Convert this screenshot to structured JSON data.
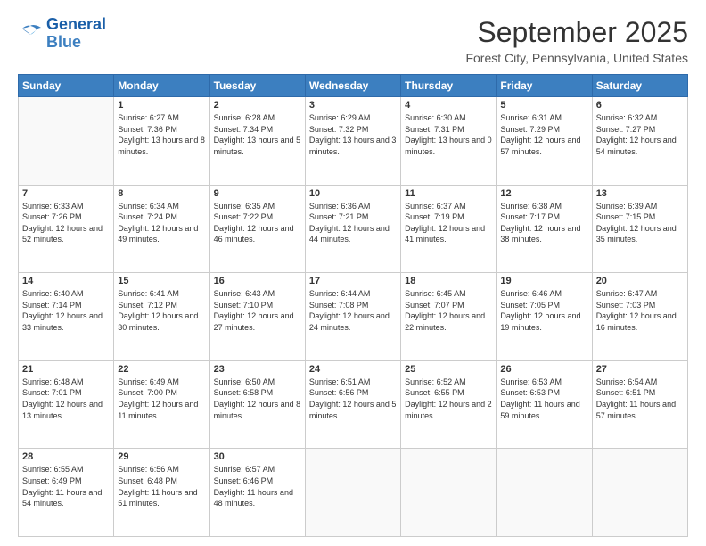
{
  "header": {
    "logo_line1": "General",
    "logo_line2": "Blue",
    "month": "September 2025",
    "location": "Forest City, Pennsylvania, United States"
  },
  "days_of_week": [
    "Sunday",
    "Monday",
    "Tuesday",
    "Wednesday",
    "Thursday",
    "Friday",
    "Saturday"
  ],
  "weeks": [
    [
      {
        "day": "",
        "sunrise": "",
        "sunset": "",
        "daylight": ""
      },
      {
        "day": "1",
        "sunrise": "Sunrise: 6:27 AM",
        "sunset": "Sunset: 7:36 PM",
        "daylight": "Daylight: 13 hours and 8 minutes."
      },
      {
        "day": "2",
        "sunrise": "Sunrise: 6:28 AM",
        "sunset": "Sunset: 7:34 PM",
        "daylight": "Daylight: 13 hours and 5 minutes."
      },
      {
        "day": "3",
        "sunrise": "Sunrise: 6:29 AM",
        "sunset": "Sunset: 7:32 PM",
        "daylight": "Daylight: 13 hours and 3 minutes."
      },
      {
        "day": "4",
        "sunrise": "Sunrise: 6:30 AM",
        "sunset": "Sunset: 7:31 PM",
        "daylight": "Daylight: 13 hours and 0 minutes."
      },
      {
        "day": "5",
        "sunrise": "Sunrise: 6:31 AM",
        "sunset": "Sunset: 7:29 PM",
        "daylight": "Daylight: 12 hours and 57 minutes."
      },
      {
        "day": "6",
        "sunrise": "Sunrise: 6:32 AM",
        "sunset": "Sunset: 7:27 PM",
        "daylight": "Daylight: 12 hours and 54 minutes."
      }
    ],
    [
      {
        "day": "7",
        "sunrise": "Sunrise: 6:33 AM",
        "sunset": "Sunset: 7:26 PM",
        "daylight": "Daylight: 12 hours and 52 minutes."
      },
      {
        "day": "8",
        "sunrise": "Sunrise: 6:34 AM",
        "sunset": "Sunset: 7:24 PM",
        "daylight": "Daylight: 12 hours and 49 minutes."
      },
      {
        "day": "9",
        "sunrise": "Sunrise: 6:35 AM",
        "sunset": "Sunset: 7:22 PM",
        "daylight": "Daylight: 12 hours and 46 minutes."
      },
      {
        "day": "10",
        "sunrise": "Sunrise: 6:36 AM",
        "sunset": "Sunset: 7:21 PM",
        "daylight": "Daylight: 12 hours and 44 minutes."
      },
      {
        "day": "11",
        "sunrise": "Sunrise: 6:37 AM",
        "sunset": "Sunset: 7:19 PM",
        "daylight": "Daylight: 12 hours and 41 minutes."
      },
      {
        "day": "12",
        "sunrise": "Sunrise: 6:38 AM",
        "sunset": "Sunset: 7:17 PM",
        "daylight": "Daylight: 12 hours and 38 minutes."
      },
      {
        "day": "13",
        "sunrise": "Sunrise: 6:39 AM",
        "sunset": "Sunset: 7:15 PM",
        "daylight": "Daylight: 12 hours and 35 minutes."
      }
    ],
    [
      {
        "day": "14",
        "sunrise": "Sunrise: 6:40 AM",
        "sunset": "Sunset: 7:14 PM",
        "daylight": "Daylight: 12 hours and 33 minutes."
      },
      {
        "day": "15",
        "sunrise": "Sunrise: 6:41 AM",
        "sunset": "Sunset: 7:12 PM",
        "daylight": "Daylight: 12 hours and 30 minutes."
      },
      {
        "day": "16",
        "sunrise": "Sunrise: 6:43 AM",
        "sunset": "Sunset: 7:10 PM",
        "daylight": "Daylight: 12 hours and 27 minutes."
      },
      {
        "day": "17",
        "sunrise": "Sunrise: 6:44 AM",
        "sunset": "Sunset: 7:08 PM",
        "daylight": "Daylight: 12 hours and 24 minutes."
      },
      {
        "day": "18",
        "sunrise": "Sunrise: 6:45 AM",
        "sunset": "Sunset: 7:07 PM",
        "daylight": "Daylight: 12 hours and 22 minutes."
      },
      {
        "day": "19",
        "sunrise": "Sunrise: 6:46 AM",
        "sunset": "Sunset: 7:05 PM",
        "daylight": "Daylight: 12 hours and 19 minutes."
      },
      {
        "day": "20",
        "sunrise": "Sunrise: 6:47 AM",
        "sunset": "Sunset: 7:03 PM",
        "daylight": "Daylight: 12 hours and 16 minutes."
      }
    ],
    [
      {
        "day": "21",
        "sunrise": "Sunrise: 6:48 AM",
        "sunset": "Sunset: 7:01 PM",
        "daylight": "Daylight: 12 hours and 13 minutes."
      },
      {
        "day": "22",
        "sunrise": "Sunrise: 6:49 AM",
        "sunset": "Sunset: 7:00 PM",
        "daylight": "Daylight: 12 hours and 11 minutes."
      },
      {
        "day": "23",
        "sunrise": "Sunrise: 6:50 AM",
        "sunset": "Sunset: 6:58 PM",
        "daylight": "Daylight: 12 hours and 8 minutes."
      },
      {
        "day": "24",
        "sunrise": "Sunrise: 6:51 AM",
        "sunset": "Sunset: 6:56 PM",
        "daylight": "Daylight: 12 hours and 5 minutes."
      },
      {
        "day": "25",
        "sunrise": "Sunrise: 6:52 AM",
        "sunset": "Sunset: 6:55 PM",
        "daylight": "Daylight: 12 hours and 2 minutes."
      },
      {
        "day": "26",
        "sunrise": "Sunrise: 6:53 AM",
        "sunset": "Sunset: 6:53 PM",
        "daylight": "Daylight: 11 hours and 59 minutes."
      },
      {
        "day": "27",
        "sunrise": "Sunrise: 6:54 AM",
        "sunset": "Sunset: 6:51 PM",
        "daylight": "Daylight: 11 hours and 57 minutes."
      }
    ],
    [
      {
        "day": "28",
        "sunrise": "Sunrise: 6:55 AM",
        "sunset": "Sunset: 6:49 PM",
        "daylight": "Daylight: 11 hours and 54 minutes."
      },
      {
        "day": "29",
        "sunrise": "Sunrise: 6:56 AM",
        "sunset": "Sunset: 6:48 PM",
        "daylight": "Daylight: 11 hours and 51 minutes."
      },
      {
        "day": "30",
        "sunrise": "Sunrise: 6:57 AM",
        "sunset": "Sunset: 6:46 PM",
        "daylight": "Daylight: 11 hours and 48 minutes."
      },
      {
        "day": "",
        "sunrise": "",
        "sunset": "",
        "daylight": ""
      },
      {
        "day": "",
        "sunrise": "",
        "sunset": "",
        "daylight": ""
      },
      {
        "day": "",
        "sunrise": "",
        "sunset": "",
        "daylight": ""
      },
      {
        "day": "",
        "sunrise": "",
        "sunset": "",
        "daylight": ""
      }
    ]
  ]
}
